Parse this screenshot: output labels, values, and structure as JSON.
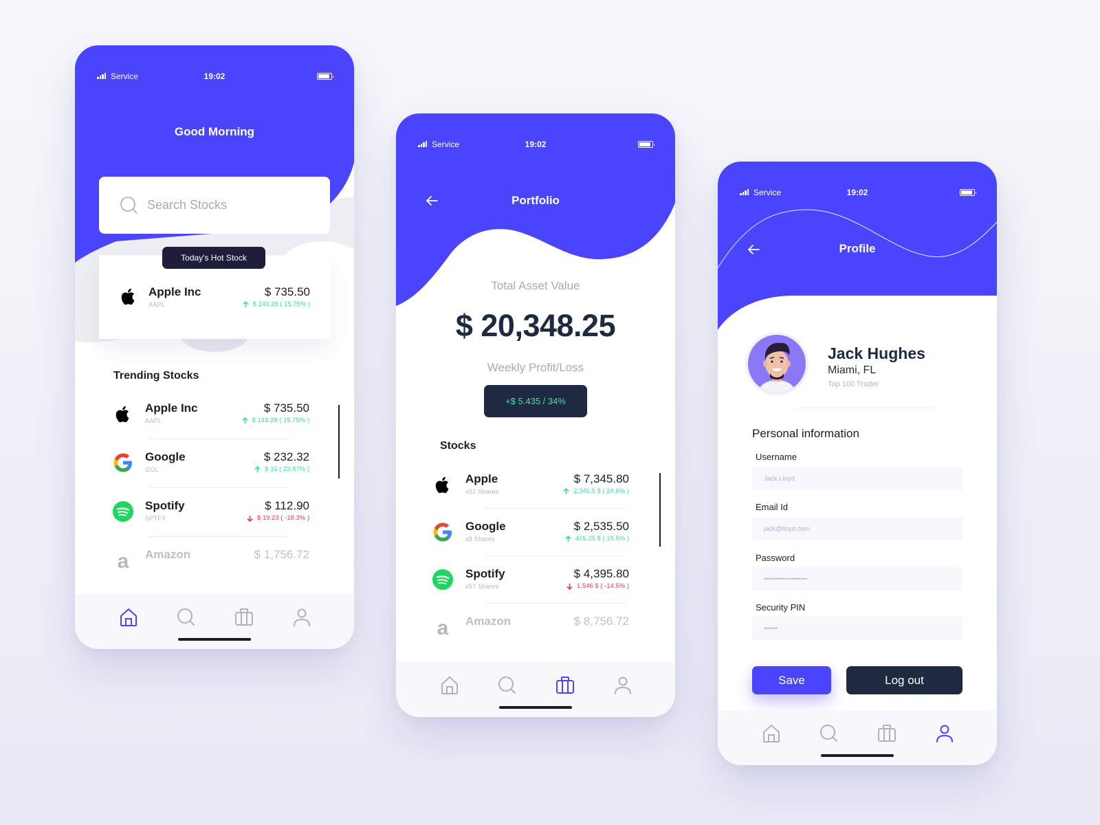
{
  "theme": {
    "accent": "#4a44fd",
    "dark": "#1e2a40",
    "gain": "#34e0a1",
    "loss": "#f0394d",
    "muted": "#a8aabb"
  },
  "statusbar": {
    "service": "Service",
    "time": "19:02"
  },
  "home": {
    "greeting": "Good Morning",
    "search_placeholder": "Search Stocks",
    "hot_stock_badge": "Today's Hot Stock",
    "hot_stock": {
      "name": "Apple Inc",
      "ticker": "AAPL",
      "price": "$ 735.50",
      "change": "$ 143.28 ( 15.75% )",
      "direction": "up",
      "logo": "apple-logo"
    },
    "trending_title": "Trending Stocks",
    "trending": [
      {
        "name": "Apple Inc",
        "ticker": "AAPL",
        "price": "$ 735.50",
        "change": "$ 143.28 ( 15.75% )",
        "direction": "up",
        "logo": "apple-logo"
      },
      {
        "name": "Google",
        "ticker": "GGL",
        "price": "$ 232.32",
        "change": "$ 32 ( 23.87% )",
        "direction": "up",
        "logo": "google-logo"
      },
      {
        "name": "Spotify",
        "ticker": "SPTFY",
        "price": "$ 112.90",
        "change": "$ 19.23 ( -18.3% )",
        "direction": "down",
        "logo": "spotify-logo"
      },
      {
        "name": "Amazon",
        "ticker": "",
        "price": "$ 1,756.72",
        "change": "",
        "direction": "",
        "logo": "amazon-logo"
      }
    ],
    "active_tab": "home"
  },
  "portfolio": {
    "title": "Portfolio",
    "total_label": "Total Asset Value",
    "total_value": "$ 20,348.25",
    "weekly_label": "Weekly Profit/Loss",
    "weekly_value": "+$ 5.435 / 34%",
    "stocks_title": "Stocks",
    "stocks": [
      {
        "name": "Apple",
        "shares": "x32 Shares",
        "price": "$ 7,345.80",
        "change": "2,346.5 $ ( 24.6% )",
        "direction": "up",
        "logo": "apple-logo"
      },
      {
        "name": "Google",
        "shares": "x8 Shares",
        "price": "$ 2,535.50",
        "change": "415.25 $ ( 19.5% )",
        "direction": "up",
        "logo": "google-logo"
      },
      {
        "name": "Spotify",
        "shares": "x57 Shares",
        "price": "$ 4,395.80",
        "change": "1,546 $ ( -14.5% )",
        "direction": "down",
        "logo": "spotify-logo"
      },
      {
        "name": "Amazon",
        "shares": "",
        "price": "$ 8,756.72",
        "change": "",
        "direction": "",
        "logo": "amazon-logo"
      }
    ],
    "active_tab": "portfolio"
  },
  "profile": {
    "title": "Profile",
    "name": "Jack Hughes",
    "city": "Miami, FL",
    "rank": "Top 100 Trader",
    "section_title": "Personal information",
    "fields": [
      {
        "label": "Username",
        "value": "Jack Lloyd"
      },
      {
        "label": "Email Id",
        "value": "jack@lloyd.com"
      },
      {
        "label": "Password",
        "value": "•••••••••••••••••••"
      },
      {
        "label": "Security PIN",
        "value": "••••••"
      }
    ],
    "save_label": "Save",
    "logout_label": "Log out",
    "active_tab": "profile"
  },
  "tabs": [
    {
      "id": "home",
      "icon": "home-icon"
    },
    {
      "id": "search",
      "icon": "search-icon"
    },
    {
      "id": "portfolio",
      "icon": "briefcase-icon"
    },
    {
      "id": "profile",
      "icon": "user-icon"
    }
  ]
}
